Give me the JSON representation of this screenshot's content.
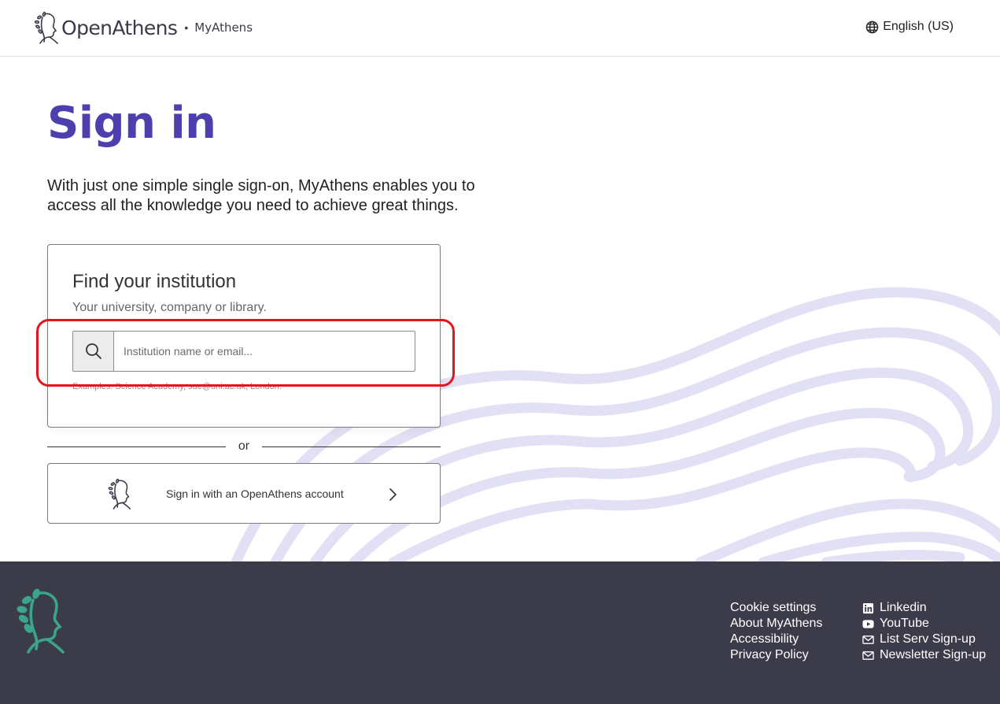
{
  "header": {
    "brand": "OpenAthens",
    "separator": "•",
    "product": "MyAthens",
    "language": "English (US)"
  },
  "main": {
    "title": "Sign in",
    "intro": "With just one simple single sign-on, MyAthens enables you to access all the knowledge you need to achieve great things."
  },
  "institution": {
    "title": "Find your institution",
    "subtitle": "Your university, company or library.",
    "placeholder": "Institution name or email...",
    "examples": "Examples: Science Academy, sue@uni.ac.uk, London."
  },
  "divider_text": "or",
  "openathens_button": {
    "label": "Sign in with an OpenAthens account"
  },
  "footer": {
    "links": [
      "Cookie settings",
      "About MyAthens",
      "Accessibility",
      "Privacy Policy"
    ],
    "social": [
      {
        "label": "Linkedin",
        "icon": "linkedin-icon"
      },
      {
        "label": "YouTube",
        "icon": "youtube-icon"
      },
      {
        "label": "List Serv Sign-up",
        "icon": "mail-icon"
      },
      {
        "label": "Newsletter Sign-up",
        "icon": "mail-icon"
      }
    ]
  },
  "colors": {
    "accent": "#4d3fae",
    "footer_bg": "#3c3b4a",
    "footer_logo": "#3aa58a",
    "highlight": "#e0161f",
    "waves": "#e2e0f4"
  }
}
